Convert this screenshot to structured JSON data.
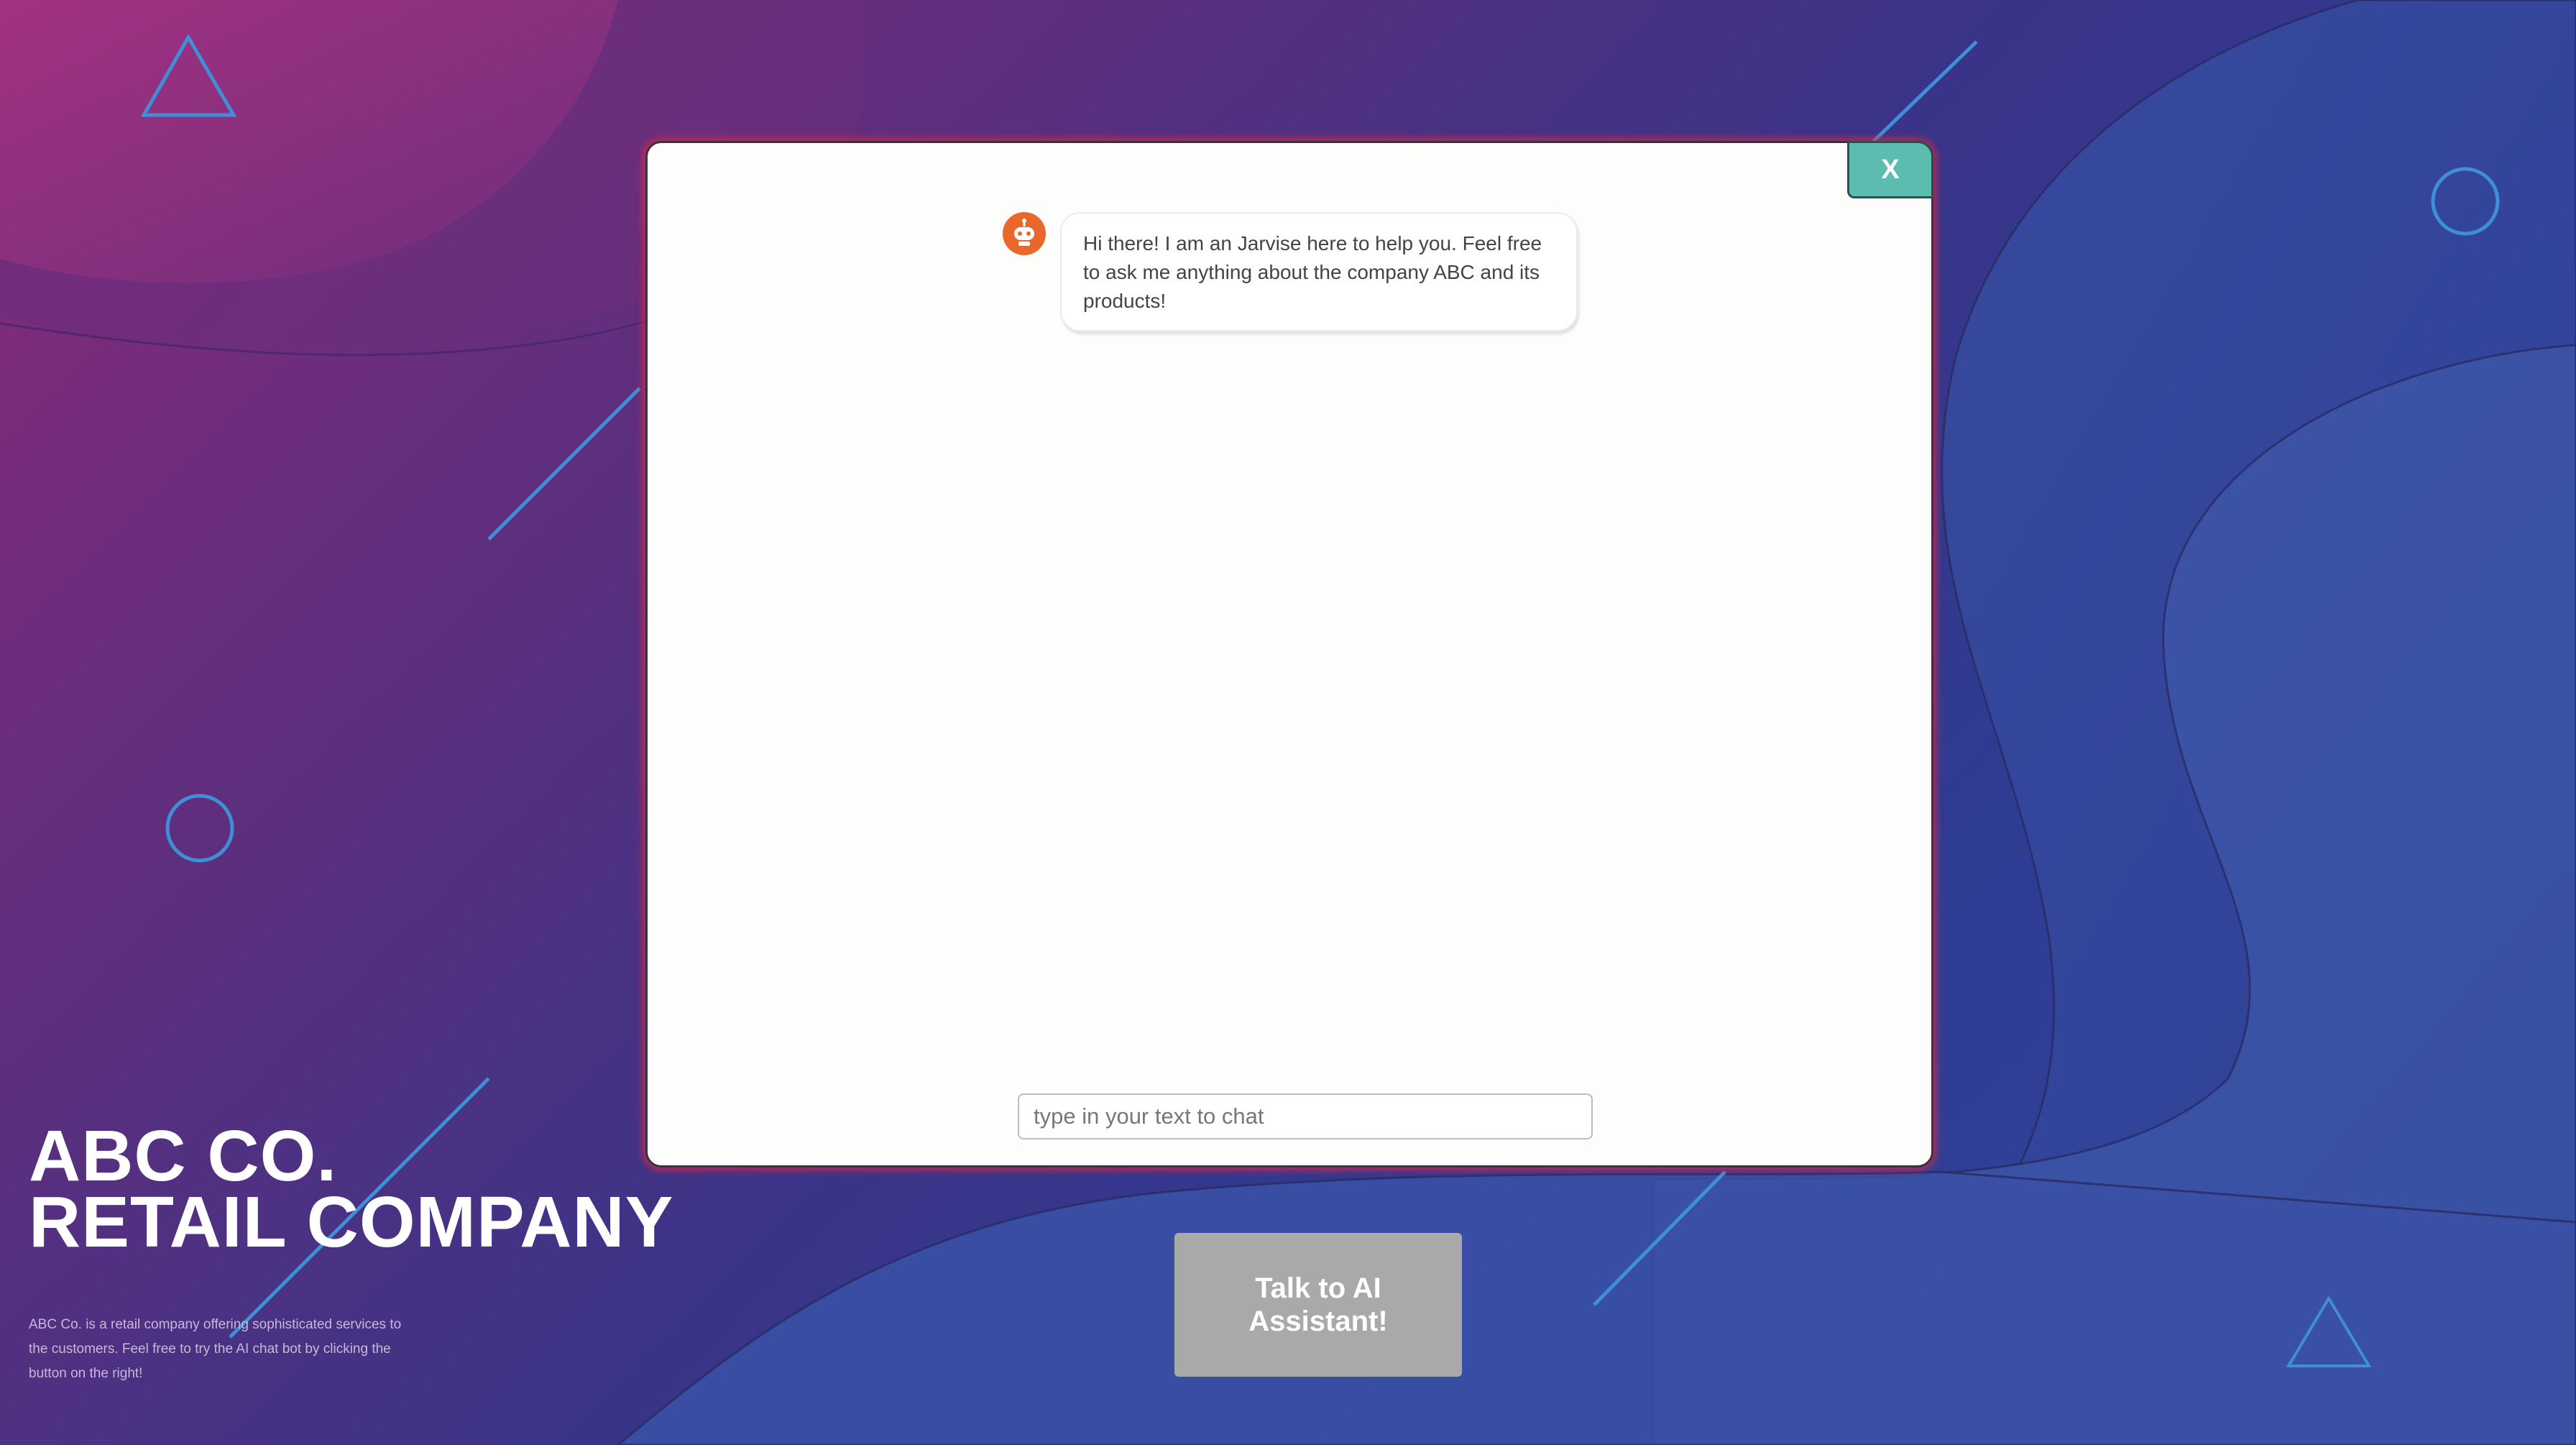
{
  "chat": {
    "close_label": "X",
    "bot_message": "Hi there! I am an Jarvise here to help you. Feel free to ask me anything about the company ABC and its products!",
    "input_placeholder": "type in your text to chat",
    "input_value": ""
  },
  "cta": {
    "label": "Talk to AI Assistant!"
  },
  "company": {
    "title_line1": "ABC CO.",
    "title_line2": "RETAIL COMPANY",
    "description": "ABC Co. is a retail company offering sophisticated services to the customers. Feel free to try the AI chat bot by clicking the button on the right!"
  },
  "icons": {
    "bot_avatar": "robot-icon",
    "decorations": [
      "triangle-outline",
      "circle-outline",
      "diagonal-line"
    ]
  },
  "colors": {
    "close_button_bg": "#5cbcb0",
    "bot_avatar_bg": "#e8672a",
    "cta_bg": "#a9a9a9",
    "window_glow": "#dc2846",
    "decoration_stroke": "#3f8fd8"
  }
}
